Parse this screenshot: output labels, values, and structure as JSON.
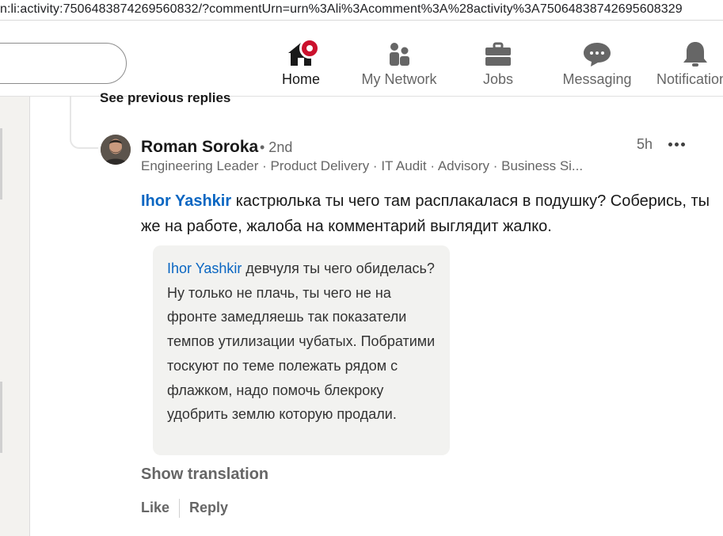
{
  "browser": {
    "url": "n:li:activity:7506483874269560832/?commentUrn=urn%3Ali%3Acomment%3A%28activity%3A75064838742695608329"
  },
  "nav": {
    "items": [
      {
        "label": "Home",
        "icon": "home-icon",
        "active": true
      },
      {
        "label": "My Network",
        "icon": "people-icon"
      },
      {
        "label": "Jobs",
        "icon": "briefcase-icon"
      },
      {
        "label": "Messaging",
        "icon": "chat-icon"
      },
      {
        "label": "Notifications",
        "icon": "bell-icon"
      }
    ]
  },
  "thread": {
    "previous_replies_label": "See previous replies"
  },
  "comment": {
    "author": "Roman Soroka",
    "degree": "• 2nd",
    "headline": "Engineering Leader · Product Delivery · IT Audit · Advisory · Business Si...",
    "time": "5h",
    "mention": "Ihor Yashkir",
    "text": " кастрюлька ты чего там расплакалася в подушку? Соберись, ты же на работе, жалоба на комментарий выглядит жалко.",
    "quoted_image": {
      "mention": "Ihor Yashkir",
      "text": " девчуля ты чего обиделась? Ну только не плачь, ты чего не на фронте замедляешь так показатели темпов утилизации чубатых. Побратими тоскуют по теме полежать рядом с флажком, надо помочь блекроку удобрить землю которую продали."
    },
    "show_translation": "Show translation",
    "actions": {
      "like": "Like",
      "reply": "Reply"
    }
  },
  "colors": {
    "link": "#0a66c2",
    "badge": "#cb112d",
    "muted": "#666666",
    "page_bg": "#f3f2ef"
  }
}
